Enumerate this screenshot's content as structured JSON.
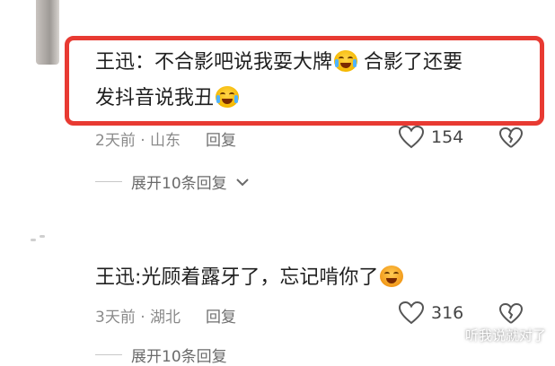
{
  "comment1": {
    "line1": "王迅：不合影吧说我耍大牌",
    "line1_after_emoji": "  合影了还要",
    "line2": "发抖音说我丑",
    "emoji1": "laugh-cry-emoji",
    "emoji2": "crying-emoji",
    "time": "2天前",
    "location": "山东",
    "reply_label": "回复",
    "likes": "154",
    "expand_label": "展开10条回复"
  },
  "comment2": {
    "line1": "王迅:光顾着露牙了，忘记啃你了",
    "emoji": "angry-emoji",
    "time": "3天前",
    "location": "湖北",
    "reply_label": "回复",
    "likes": "316",
    "expand_label": "展开10条回复"
  },
  "watermark": "听我说就对了",
  "colors": {
    "highlight": "#e83a32",
    "text": "#1f1f1f",
    "meta": "#8a8a8a"
  }
}
